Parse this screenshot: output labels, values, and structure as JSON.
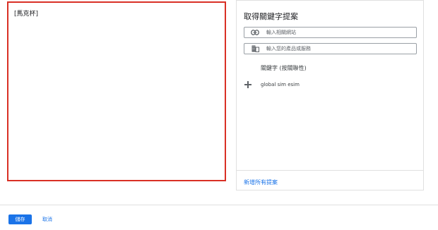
{
  "editor": {
    "value": "[馬克杯]"
  },
  "panel": {
    "title": "取得關鍵字提案",
    "url_field": {
      "icon": "link-icon",
      "placeholder": "輸入相關網站"
    },
    "product_field": {
      "icon": "product-icon",
      "placeholder": "輸入您的產品或服務"
    },
    "section_label": "關鍵字 (按關聯性)",
    "suggestions": [
      {
        "icon": "plus-icon",
        "label": "global sim esim"
      }
    ],
    "add_all_label": "新增所有提案"
  },
  "footer": {
    "save_label": "儲存",
    "cancel_label": "取消"
  },
  "colors": {
    "highlight_border": "#d93025",
    "accent": "#1a73e8"
  }
}
